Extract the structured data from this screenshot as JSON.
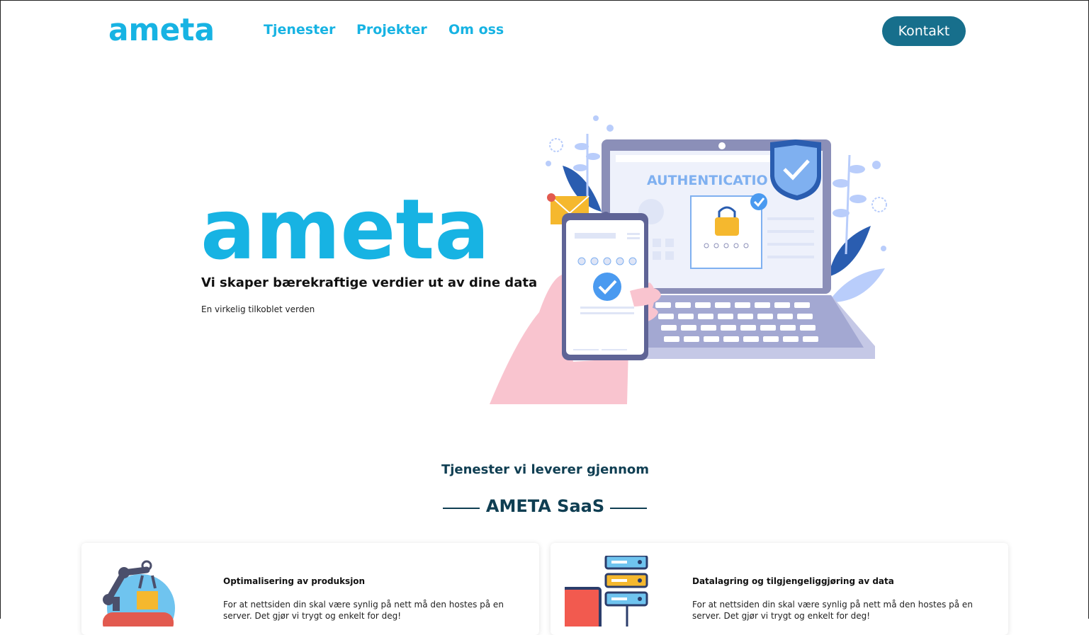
{
  "header": {
    "logo_text": "ameta",
    "nav": [
      {
        "label": "Tjenester"
      },
      {
        "label": "Projekter"
      },
      {
        "label": "Om oss"
      }
    ],
    "contact_label": "Kontakt"
  },
  "hero": {
    "logo_text": "ameta",
    "tagline": "Vi skaper bærekraftige verdier ut av dine data",
    "subtitle": "En virkelig tilkoblet verden",
    "illustration_text": "AUTHENTICATIO"
  },
  "services": {
    "lead": "Tjenester vi leverer gjennom",
    "title": "AMETA SaaS",
    "cards": [
      {
        "title": "Optimalisering av produksjon",
        "text": "For at nettsiden din skal være synlig på nett må den hostes på en server. Det gjør vi trygt og enkelt for deg!",
        "icon": "robot-arm-icon"
      },
      {
        "title": "Datalagring og tilgjengeliggjøring av data",
        "text": "For at nettsiden din skal være synlig på nett må den hostes på en server. Det gjør vi trygt og enkelt for deg!",
        "icon": "server-stack-icon"
      }
    ]
  },
  "colors": {
    "brand_blue": "#17b3e3",
    "dark_teal": "#176f8c",
    "heading_navy": "#0f3e52"
  }
}
